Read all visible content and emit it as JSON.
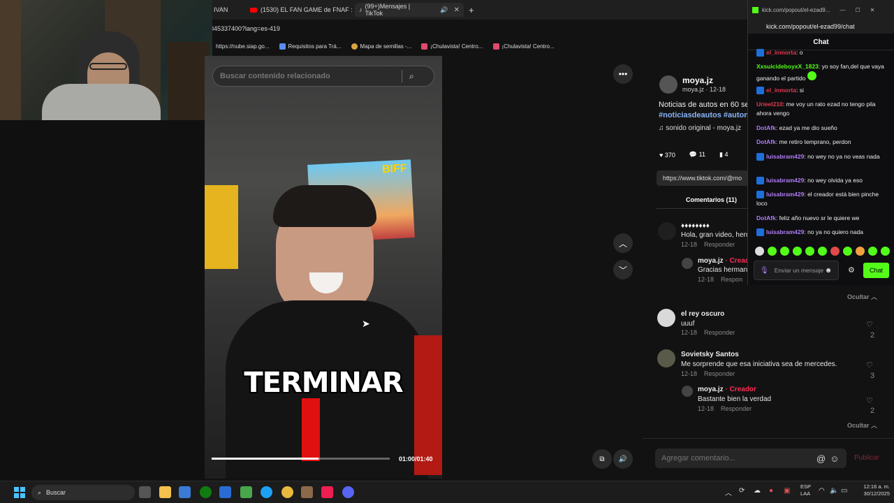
{
  "browser": {
    "tabs": [
      {
        "label": "IVAN"
      },
      {
        "label": "(1530) EL FAN GAME de FNAF :"
      },
      {
        "label": "(99+)Mensajes | TikTok"
      }
    ],
    "address": "l45337400?lang=es-419",
    "bookmarks": [
      "https://nube.siap.go...",
      "Requisitos para Trá...",
      "Mapa de semillas -...",
      "¡Chulavista! Centro...",
      "¡Chulavista! Centro..."
    ]
  },
  "search": {
    "placeholder": "Buscar contenido relacionado"
  },
  "video": {
    "caption": "TERMINAR",
    "time": "01:00/01:40",
    "progress": 0.6,
    "poster": "BIFF"
  },
  "post": {
    "author": "moya.jz",
    "handle_date": "moya.jz · 12-18",
    "description": "Noticias de autos en 60 se",
    "hashtags": "#noticiasdeautos #autonc",
    "sound": "sonido original - moya.jz",
    "likes": "370",
    "comments": "11",
    "saves": "4",
    "link": "https://www.tiktok.com/@mo",
    "comments_tab": "Comentarios (11)"
  },
  "comments": [
    {
      "name": "♦♦♦♦♦♦♦♦",
      "text": "Hola, gran video, herm",
      "date": "12-18",
      "reply": "Responder"
    },
    {
      "name": "moya.jz",
      "badge": "· Creador",
      "text": "Gracias hermano",
      "date": "12-18",
      "reply": "Respon"
    },
    {
      "name": "el rey oscuro",
      "text": "uuuf",
      "date": "12-18",
      "reply": "Responder",
      "likes": "2"
    },
    {
      "name": "Sovietsky Santos",
      "text": "Me sorprende que esa iniciativa sea de mercedes.",
      "date": "12-18",
      "reply": "Responder",
      "likes": "3"
    },
    {
      "name": "moya.jz",
      "badge": "· Creador",
      "text": "Bastante bien la verdad",
      "date": "12-18",
      "reply": "Responder",
      "likes": "2"
    }
  ],
  "hide_label": "Ocultar",
  "comment_input": {
    "placeholder": "Agregar comentario...",
    "publish": "Publicar"
  },
  "kick": {
    "window_title": "kick.com/popout/el-ezad9...",
    "url": "kick.com/popout/el-ezad99/chat",
    "header": "Chat",
    "messages": [
      {
        "user": "el_inmorta",
        "color": "#e4394f",
        "text": ": o"
      },
      {
        "user": "XxsuicideboyxX_1823",
        "color": "#53fc18",
        "text": ": yo soy fan,del que vaya ganando el partido"
      },
      {
        "user": "el_inmorta",
        "color": "#e4394f",
        "text": ": si"
      },
      {
        "user": "Urieel210",
        "color": "#e4394f",
        "text": ": me voy un rato ezad no tengo pila ahora vengo"
      },
      {
        "user": "DotAfk",
        "color": "#b07cf7",
        "text": ": ezad ya me dio sueño"
      },
      {
        "user": "DotAfk",
        "color": "#b07cf7",
        "text": ": me retiro temprano, perdon"
      },
      {
        "user": "luisabram429",
        "color": "#b07cf7",
        "text": ": no wey no ya no veas nada"
      },
      {
        "user": "luisabram429",
        "color": "#b07cf7",
        "text": ": no wey olvida ya eso"
      },
      {
        "user": "luisabram429",
        "color": "#b07cf7",
        "text": ": el creador está bien pinche loco"
      },
      {
        "user": "DotAfk",
        "color": "#b07cf7",
        "text": ": feliz año nuevo sr le quiere we"
      },
      {
        "user": "luisabram429",
        "color": "#b07cf7",
        "text": ": no ya no quiero nada"
      }
    ],
    "input_placeholder": "Enviar un mensaje",
    "send": "Chat",
    "accent": "#53fc18"
  },
  "taskbar": {
    "search": "Buscar",
    "lang": "ESP",
    "lang2": "LAA",
    "time": "12:16 a. m.",
    "date": "30/12/2025"
  }
}
